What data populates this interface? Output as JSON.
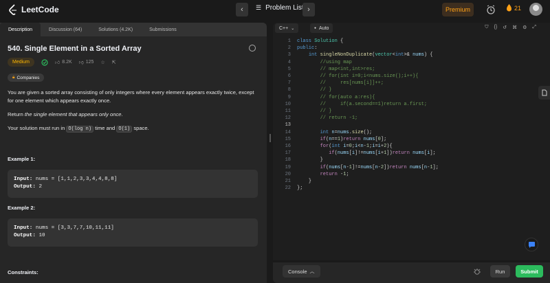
{
  "topbar": {
    "logo_text": "LeetCode",
    "prev_icon": "chevron-left-icon",
    "next_icon": "chevron-right-icon",
    "problem_list_label": "Problem List",
    "premium_label": "Premium",
    "streak_count": "21"
  },
  "left_tabs": [
    "Description",
    "Discussion (64)",
    "Solutions (4.2K)",
    "Submissions"
  ],
  "problem": {
    "title": "540. Single Element in a Sorted Array",
    "difficulty": "Medium",
    "likes": "8.2K",
    "dislikes": "125",
    "companies_label": "Companies",
    "desc_p1": "You are given a sorted array consisting of only integers where every element appears exactly twice, except for one element which appears exactly once.",
    "desc_p2_prefix": "Return ",
    "desc_p2_em": "the single element that appears only once",
    "desc_p2_suffix": ".",
    "desc_p3_prefix": "Your solution must run in ",
    "desc_p3_code1": "O(log n)",
    "desc_p3_mid": " time and ",
    "desc_p3_code2": "O(1)",
    "desc_p3_suffix": " space.",
    "example1_heading": "Example 1:",
    "example1_input_label": "Input:",
    "example1_input_value": " nums = [1,1,2,3,3,4,4,8,8]",
    "example1_output_label": "Output:",
    "example1_output_value": " 2",
    "example2_heading": "Example 2:",
    "example2_input_label": "Input:",
    "example2_input_value": " nums = [3,3,7,7,10,11,11]",
    "example2_output_label": "Output:",
    "example2_output_value": " 10",
    "constraints_heading": "Constraints:"
  },
  "editor": {
    "language": "C++",
    "autocomplete": "Auto",
    "line_numbers": [
      "1",
      "2",
      "3",
      "4",
      "5",
      "6",
      "7",
      "8",
      "9",
      "10",
      "11",
      "12",
      "13",
      "14",
      "15",
      "16",
      "17",
      "18",
      "19",
      "20",
      "21",
      "22"
    ]
  },
  "bottom": {
    "console_label": "Console",
    "run_label": "Run",
    "submit_label": "Submit"
  },
  "colors": {
    "accent_orange": "#ffa116",
    "submit_green": "#2cbb5d",
    "medium_yellow": "#ffb800"
  }
}
